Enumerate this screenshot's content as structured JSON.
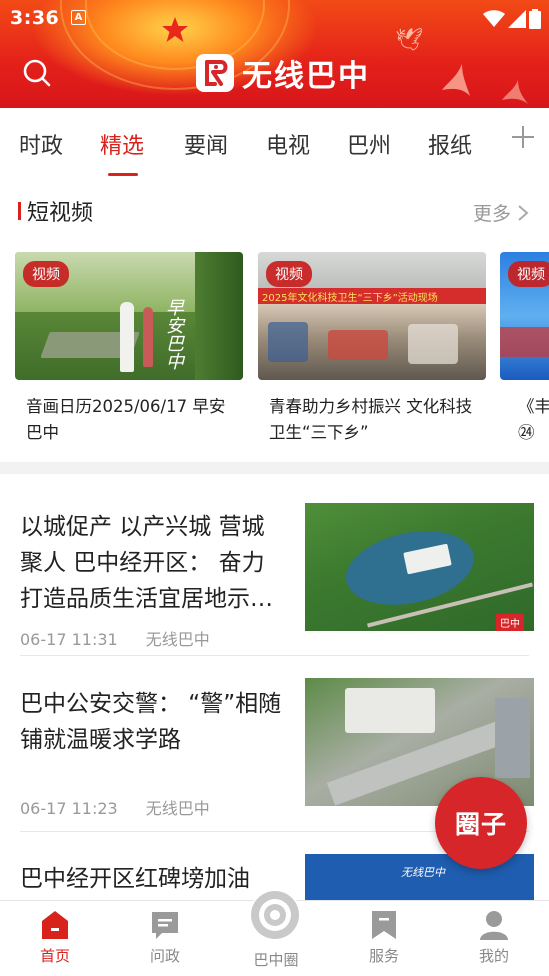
{
  "status_bar": {
    "time": "3:36",
    "notif_letter": "A"
  },
  "header": {
    "app_title": "无线巴中",
    "search_icon": "search-icon"
  },
  "tabs": [
    {
      "label": "时政",
      "active": false
    },
    {
      "label": "精选",
      "active": true
    },
    {
      "label": "要闻",
      "active": false
    },
    {
      "label": "电视",
      "active": false
    },
    {
      "label": "巴州",
      "active": false
    },
    {
      "label": "报纸",
      "active": false
    }
  ],
  "short_video": {
    "title": "短视频",
    "more_label": "更多",
    "items": [
      {
        "badge": "视频",
        "title": "音画日历2025/06/17 早安巴中",
        "overlay": "早安巴中"
      },
      {
        "badge": "视频",
        "title": "青春助力乡村振兴 文化科技卫生“三下乡”",
        "banner": "2025年文化科技卫生“三下乡”活动现场"
      },
      {
        "badge": "视频",
        "title": "《丰",
        "extra": "㉔"
      }
    ]
  },
  "news": [
    {
      "title": "以城促产 以产兴城 营城聚人 巴中经开区： 奋力打造品质生活宜居地示…",
      "time": "06-17 11:31",
      "source": "无线巴中",
      "watermark": "巴中"
    },
    {
      "title": "巴中公安交警： “警”相随 铺就温暖求学路",
      "time": "06-17 11:23",
      "source": "无线巴中"
    },
    {
      "title": "巴中经开区红碑塝加油",
      "thumb_text": "无线巴中"
    }
  ],
  "float_button": {
    "label": "圈子"
  },
  "bottom_nav": [
    {
      "label": "首页",
      "active": true
    },
    {
      "label": "问政",
      "active": false
    },
    {
      "label": "巴中圈",
      "active": false
    },
    {
      "label": "服务",
      "active": false
    },
    {
      "label": "我的",
      "active": false
    }
  ],
  "colors": {
    "brand_red": "#d8231d",
    "header_red": "#e3201a"
  }
}
